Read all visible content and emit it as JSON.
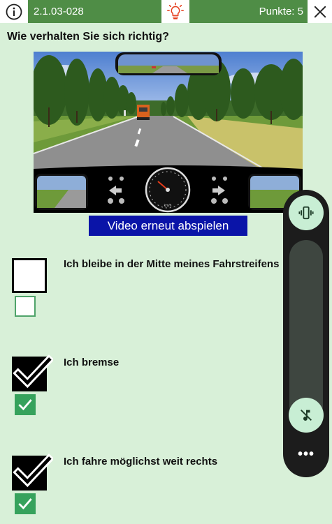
{
  "header": {
    "question_id": "2.1.03-028",
    "score": "Punkte: 5"
  },
  "question": "Wie verhalten Sie sich richtig?",
  "video_button": "Video erneut abspielen",
  "answers": [
    {
      "text": "Ich bleibe in der Mitte meines Fahrstreifens",
      "checked": false
    },
    {
      "text": "Ich bremse",
      "checked": true
    },
    {
      "text": "Ich fahre möglichst weit rechts",
      "checked": true
    }
  ],
  "dashboard": {
    "speed_unit": "km/h",
    "speed_ticks": [
      "20",
      "40",
      "60",
      "80",
      "100",
      "120",
      "140",
      "160"
    ]
  },
  "volume_panel": {
    "more_label": "•••"
  },
  "colors": {
    "header_green": "#4f8d46",
    "background": "#d8f0d8",
    "video_button": "#0a14a8",
    "check_green": "#36a25c",
    "bulb_red": "#e53b1a"
  }
}
